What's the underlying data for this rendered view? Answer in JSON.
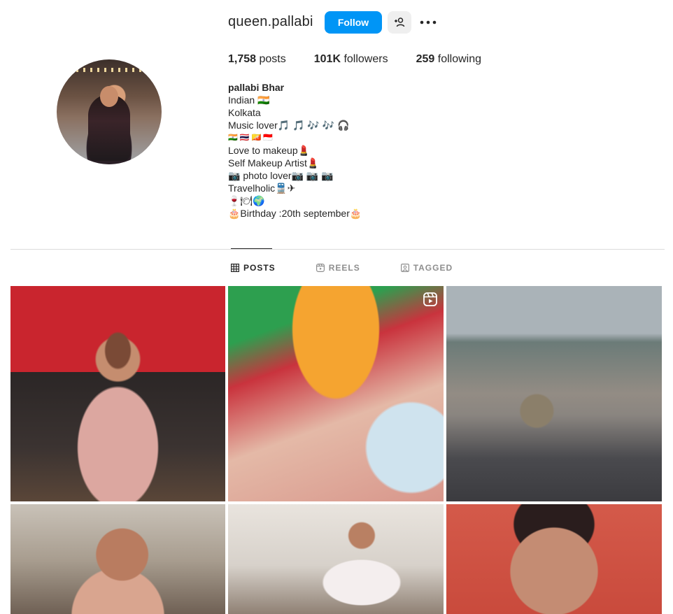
{
  "profile": {
    "username": "queen.pallabi",
    "follow_label": "Follow",
    "stats": [
      {
        "count": "1,758",
        "label": "posts"
      },
      {
        "count": "101K",
        "label": "followers"
      },
      {
        "count": "259",
        "label": "following"
      }
    ],
    "bio": {
      "name": "pallabi Bhar",
      "lines": [
        "Indian 🇮🇳",
        "Kolkata",
        "Music lover🎵 🎵 🎶 🎶 🎧",
        "🇮🇳 🇹🇭 🇧🇹 🇮🇩",
        "Love to makeup💄",
        "Self Makeup Artist💄",
        "📷 photo lover📷 📷 📷",
        "Travelholic🚆✈",
        "🍷🍽🌍",
        "🎂Birthday :20th september🎂"
      ]
    }
  },
  "tabs": [
    {
      "label": "POSTS",
      "icon": "grid-icon",
      "active": true
    },
    {
      "label": "REELS",
      "icon": "reels-icon",
      "active": false
    },
    {
      "label": "TAGGED",
      "icon": "tagged-icon",
      "active": false
    }
  ],
  "posts": [
    {
      "kind": "photo",
      "reel": false
    },
    {
      "kind": "photo",
      "reel": true
    },
    {
      "kind": "photo",
      "reel": false
    },
    {
      "kind": "photo",
      "reel": false
    },
    {
      "kind": "photo",
      "reel": false
    },
    {
      "kind": "photo",
      "reel": false
    }
  ],
  "colors": {
    "accent": "#0095f6",
    "text": "#262626",
    "muted": "#8e8e8e",
    "divider": "#dbdbdb"
  }
}
